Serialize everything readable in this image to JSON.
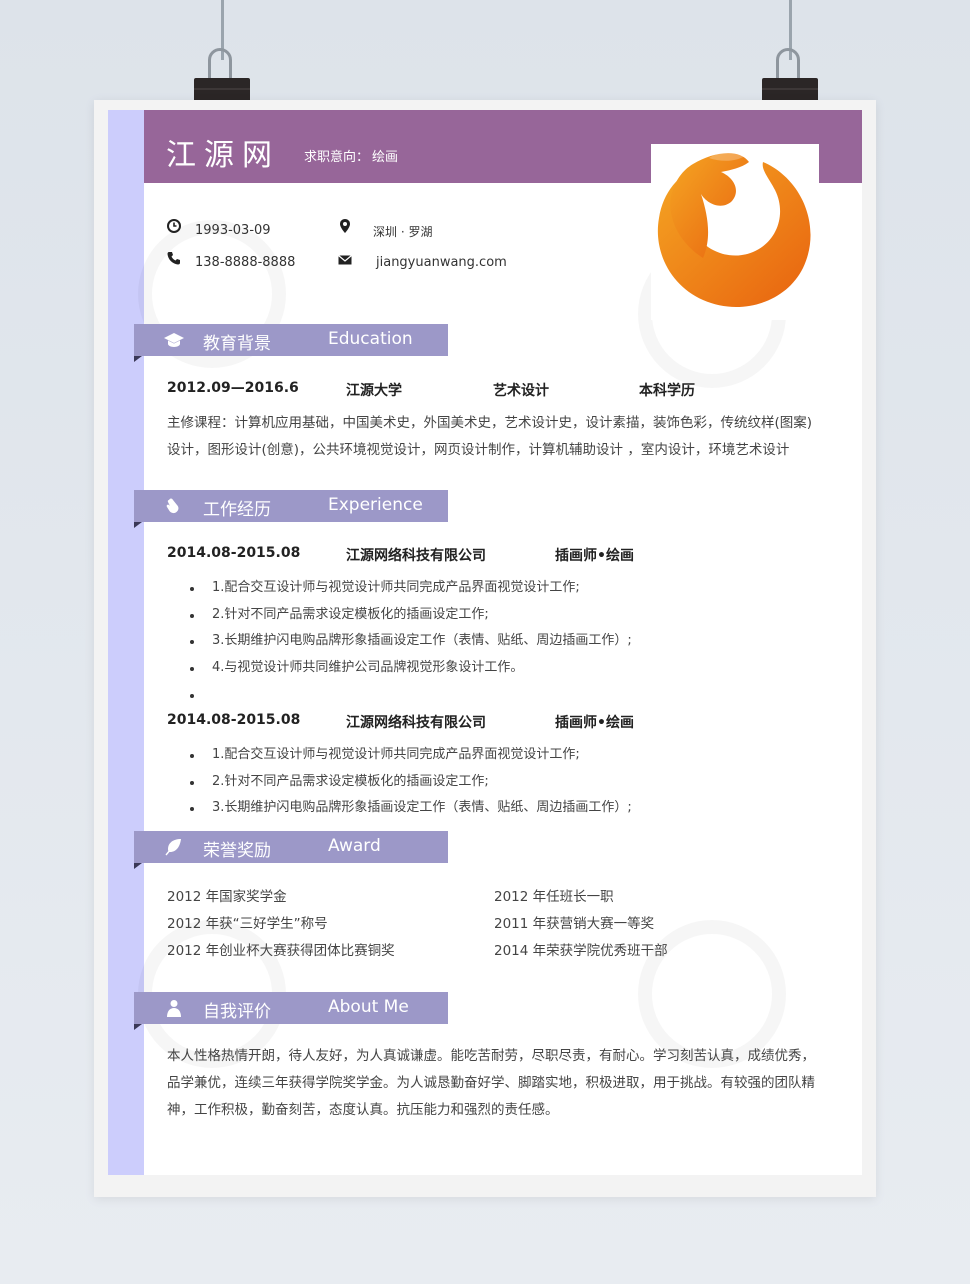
{
  "header": {
    "name": "江源网",
    "intent_label": "求职意向：",
    "intent_value": "绘画"
  },
  "contact": {
    "birthday": "1993-03-09",
    "phone": "138-8888-8888",
    "location": "深圳 · 罗湖",
    "email": "jiangyuanwang.com"
  },
  "sections": {
    "education": {
      "zh": "教育背景",
      "en": "Education",
      "icon": "graduation-cap-icon"
    },
    "experience": {
      "zh": "工作经历",
      "en": "Experience",
      "icon": "hand-icon"
    },
    "award": {
      "zh": "荣誉奖励",
      "en": "Award",
      "icon": "leaf-icon"
    },
    "about": {
      "zh": "自我评价",
      "en": "About Me",
      "icon": "person-icon"
    }
  },
  "education": {
    "period": "2012.09—2016.6",
    "school": "江源大学",
    "major": "艺术设计",
    "degree": "本科学历",
    "courses": "主修课程：计算机应用基础，中国美术史，外国美术史，艺术设计史，设计素描，装饰色彩，传统纹样(图案)设计，图形设计(创意)，公共环境视觉设计，网页设计制作，计算机辅助设计 ，室内设计，环境艺术设计"
  },
  "jobs": [
    {
      "period": "2014.08-2015.08",
      "company": "江源网络科技有限公司",
      "role": "插画师•绘画",
      "items": [
        "1.配合交互设计师与视觉设计师共同完成产品界面视觉设计工作;",
        "2.针对不同产品需求设定模板化的插画设定工作;",
        "3.长期维护闪电购品牌形象插画设定工作（表情、贴纸、周边插画工作）;",
        "4.与视觉设计师共同维护公司品牌视觉形象设计工作。",
        ""
      ]
    },
    {
      "period": "2014.08-2015.08",
      "company": "江源网络科技有限公司",
      "role": "插画师•绘画",
      "items": [
        "1.配合交互设计师与视觉设计师共同完成产品界面视觉设计工作;",
        "2.针对不同产品需求设定模板化的插画设定工作;",
        "3.长期维护闪电购品牌形象插画设定工作（表情、贴纸、周边插画工作）;"
      ]
    }
  ],
  "awards": {
    "left": [
      "2012 年国家奖学金",
      "2012 年获“三好学生”称号",
      "2012 年创业杯大赛获得团体比赛铜奖"
    ],
    "right": [
      "2012 年任班长一职",
      "2011 年获营销大赛一等奖",
      "2014 年荣获学院优秀班干部"
    ]
  },
  "about": "本人性格热情开朗，待人友好，为人真诚谦虚。能吃苦耐劳，尽职尽责，有耐心。学习刻苦认真，成绩优秀，品学兼优，连续三年获得学院奖学金。为人诚恳勤奋好学、脚踏实地，积极进取，用于挑战。有较强的团队精神，工作积极，勤奋刻苦，态度认真。抗压能力和强烈的责任感。",
  "colors": {
    "header_bg": "#976699",
    "sidebar_bg": "#cccdfc",
    "section_bg": "#9c98c8",
    "logo_orange": "#f08a1c"
  }
}
